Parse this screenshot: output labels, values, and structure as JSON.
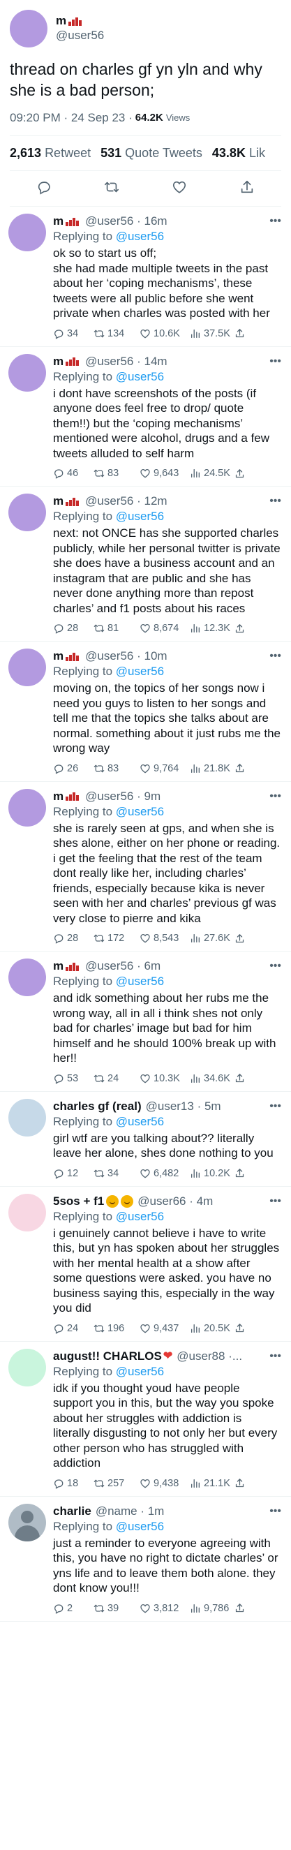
{
  "main_tweet": {
    "author_name": "m",
    "handle": "@user56",
    "text": "thread on charles gf yn yln and why she is a bad person;",
    "timestamp": "09:20 PM · 24 Sep 23 · ",
    "views_count": "64.2K",
    "views_label": "Views",
    "retweets_count": "2,613",
    "retweets_label": "Retweet",
    "quotes_count": "531",
    "quotes_label": "Quote Tweets",
    "likes_count": "43.8K",
    "likes_label": "Lik",
    "avatar_color": "#b39ae0"
  },
  "replies": [
    {
      "name": "m",
      "name_decor": "flag",
      "handle": "@user56",
      "time": "· 16m",
      "reply_prefix": "Replying to ",
      "reply_to": "@user56",
      "text": "ok so to start us off;\nshe had made multiple tweets in the past about her ‘coping mechanisms’, these tweets were all public before she went private when charles was posted with her",
      "replies": "34",
      "retweets": "134",
      "likes": "10.6K",
      "views": "37.5K",
      "avatar_color": "#b39ae0"
    },
    {
      "name": "m",
      "name_decor": "flag",
      "handle": "@user56",
      "time": "· 14m",
      "reply_prefix": "Replying to ",
      "reply_to": "@user56",
      "text": "i dont have screenshots of the posts (if anyone does feel free to drop/ quote them!!) but the ‘coping mechanisms’ mentioned were alcohol, drugs and a few tweets alluded to self harm",
      "replies": "46",
      "retweets": "83",
      "likes": "9,643",
      "views": "24.5K",
      "avatar_color": "#b39ae0"
    },
    {
      "name": "m",
      "name_decor": "flag",
      "handle": "@user56",
      "time": "· 12m",
      "reply_prefix": "Replying to ",
      "reply_to": "@user56",
      "text": "next: not ONCE has she supported charles publicly, while her personal twitter is private she does have a business account and an instagram that are public and she has never done anything more than repost charles’ and f1 posts about his races",
      "replies": "28",
      "retweets": "81",
      "likes": "8,674",
      "views": "12.3K",
      "avatar_color": "#b39ae0"
    },
    {
      "name": "m",
      "name_decor": "flag",
      "handle": "@user56",
      "time": "· 10m",
      "reply_prefix": "Replying to ",
      "reply_to": "@user56",
      "text": "moving on, the topics of her songs now i need you guys to listen to her songs and tell me that the topics she talks about are normal. something about it just rubs me the wrong way",
      "replies": "26",
      "retweets": "83",
      "likes": "9,764",
      "views": "21.8K",
      "avatar_color": "#b39ae0"
    },
    {
      "name": "m",
      "name_decor": "flag",
      "handle": "@user56",
      "time": "· 9m",
      "reply_prefix": "Replying to ",
      "reply_to": "@user56",
      "text": "she is rarely seen at gps, and when she is shes alone, either on her phone or reading. i get the feeling that the rest of the team dont really like her, including charles’ friends, especially because kika is never seen with her and charles’ previous gf was very close to pierre and kika",
      "replies": "28",
      "retweets": "172",
      "likes": "8,543",
      "views": "27.6K",
      "avatar_color": "#b39ae0"
    },
    {
      "name": "m",
      "name_decor": "flag",
      "handle": "@user56",
      "time": "· 6m",
      "reply_prefix": "Replying to ",
      "reply_to": "@user56",
      "text": "and idk something about her rubs me the wrong way, all in all i think shes not only bad for charles’ image but bad for him himself and he should 100% break up with her!!",
      "replies": "53",
      "retweets": "24",
      "likes": "10.3K",
      "views": "34.6K",
      "avatar_color": "#b39ae0"
    },
    {
      "name": "charles gf (real)",
      "name_decor": "",
      "handle": "@user13",
      "time": "· 5m",
      "reply_prefix": "Replying to ",
      "reply_to": "@user56",
      "text": "girl wtf are you talking about?? literally leave her alone, shes done nothing to you",
      "replies": "12",
      "retweets": "34",
      "likes": "6,482",
      "views": "10.2K",
      "avatar_color": "#c6d9e8"
    },
    {
      "name": "5sos + f1",
      "name_decor": "emoji",
      "handle": "@user66",
      "time": "· 4m",
      "reply_prefix": "Replying to ",
      "reply_to": "@user56",
      "text": "i genuinely cannot believe i have to write this, but yn has spoken about her struggles with her mental health at a show after some questions were asked. you have no business saying this, especially in the way you did",
      "replies": "24",
      "retweets": "196",
      "likes": "9,437",
      "views": "20.5K",
      "avatar_color": "#f8d7e3"
    },
    {
      "name": "august!! CHARLOS",
      "name_decor": "heart",
      "handle": "@user88",
      "time": "·...",
      "reply_prefix": "Replying to ",
      "reply_to": "@user56",
      "text": "idk if you thought youd have people support you in this, but the way you spoke about her struggles with addiction is literally disgusting to not only her but every other person who has struggled with addiction",
      "replies": "18",
      "retweets": "257",
      "likes": "9,438",
      "views": "21.1K",
      "avatar_color": "#c9f5dd"
    },
    {
      "name": "charlie",
      "name_decor": "",
      "handle": "@name",
      "time": "· 1m",
      "reply_prefix": "Replying to ",
      "reply_to": "@user56",
      "text": "just a reminder to everyone agreeing with this, you have no right to dictate charles’ or yns life and to leave them both alone. they dont know you!!!",
      "replies": "2",
      "retweets": "39",
      "likes": "3,812",
      "views": "9,786",
      "avatar_color": "plain"
    }
  ],
  "icons": {
    "reply": "speech-bubble-icon",
    "retweet": "retweet-arrows-icon",
    "like": "heart-icon",
    "views": "bar-chart-icon",
    "share": "share-upload-icon",
    "more": "more-dots-icon"
  },
  "colors": {
    "accent": "#1d9bf0",
    "muted": "#536471"
  }
}
